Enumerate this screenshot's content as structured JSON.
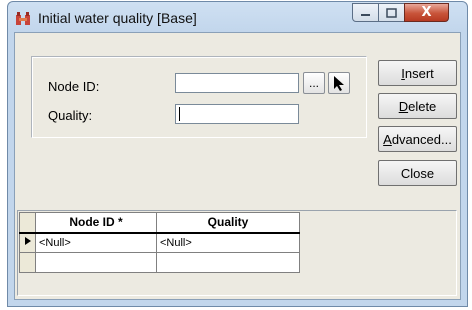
{
  "window": {
    "title": "Initial water quality [Base]",
    "icon": "app-icon",
    "caption_buttons": {
      "close_glyph": "X"
    }
  },
  "form": {
    "node_id_label": "Node ID:",
    "node_id_value": "",
    "quality_label": "Quality:",
    "quality_value": "",
    "browse_label": "...",
    "pick_icon": "pointer-arrow-icon"
  },
  "buttons": {
    "insert_prefix": "",
    "insert_hotkey": "I",
    "insert_rest": "nsert",
    "delete_hotkey": "D",
    "delete_rest": "elete",
    "advanced_hotkey": "A",
    "advanced_rest": "dvanced...",
    "close_label": "Close"
  },
  "grid": {
    "columns": [
      "Node ID *",
      "Quality"
    ],
    "rows": [
      [
        "<Null>",
        "<Null>"
      ],
      [
        "",
        ""
      ]
    ]
  },
  "colors": {
    "title_gradient": "#cfe0f2",
    "close_button": "#c8543a",
    "client_bg": "#eceae1"
  }
}
